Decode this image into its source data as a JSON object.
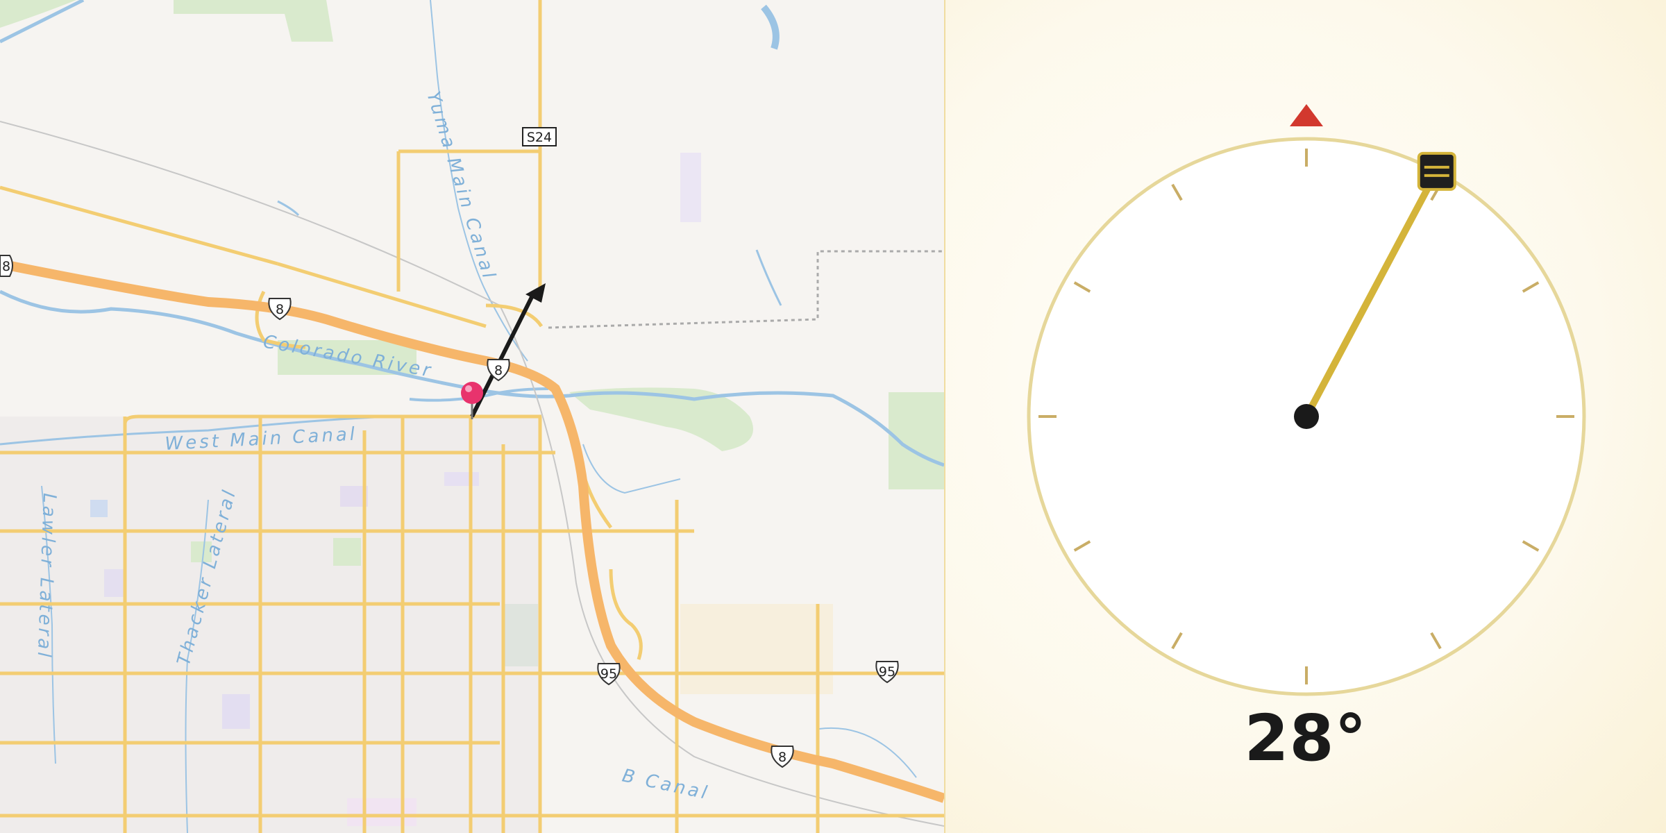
{
  "map": {
    "labels": {
      "colorado_river": "Colorado River",
      "yuma_main_canal": "Yuma Main Canal",
      "west_main_canal": "West Main Canal",
      "lawler_lateral": "Lawler Lateral",
      "thacker_lateral": "Thacker Lateral",
      "b_canal": "B Canal"
    },
    "shields": {
      "s24": "S24",
      "i8": "8",
      "us95": "95"
    },
    "pin_color": "#e8336d",
    "arrow_color": "#1a1a1a"
  },
  "compass": {
    "heading_deg": 28,
    "readout": "28°",
    "north_marker_color": "#d2382e",
    "needle_color": "#d4b43a",
    "dial_ring_color": "#e6d79a"
  }
}
